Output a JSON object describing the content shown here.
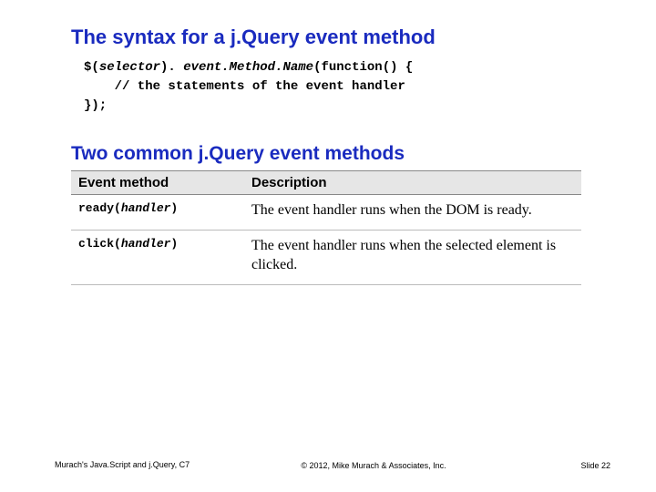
{
  "heading1": "The syntax for a j.Query event method",
  "code": {
    "line1a": "$(",
    "line1b": "selector",
    "line1c": "). ",
    "line1d": "event.Method.Name",
    "line1e": "(function() {",
    "line2": "    // the statements of the event handler",
    "line3": "});"
  },
  "heading2": "Two common j.Query event methods",
  "table": {
    "head": {
      "c1": "Event method",
      "c2": "Description"
    },
    "rows": [
      {
        "m1": "ready(",
        "m2": "handler",
        "m3": ")",
        "desc": "The event handler runs when the DOM is ready."
      },
      {
        "m1": "click(",
        "m2": "handler",
        "m3": ")",
        "desc": "The event handler runs when the selected element is clicked."
      }
    ]
  },
  "footer": {
    "left": "Murach's Java.Script and j.Query, C7",
    "center": "© 2012, Mike Murach & Associates, Inc.",
    "right": "Slide 22"
  }
}
